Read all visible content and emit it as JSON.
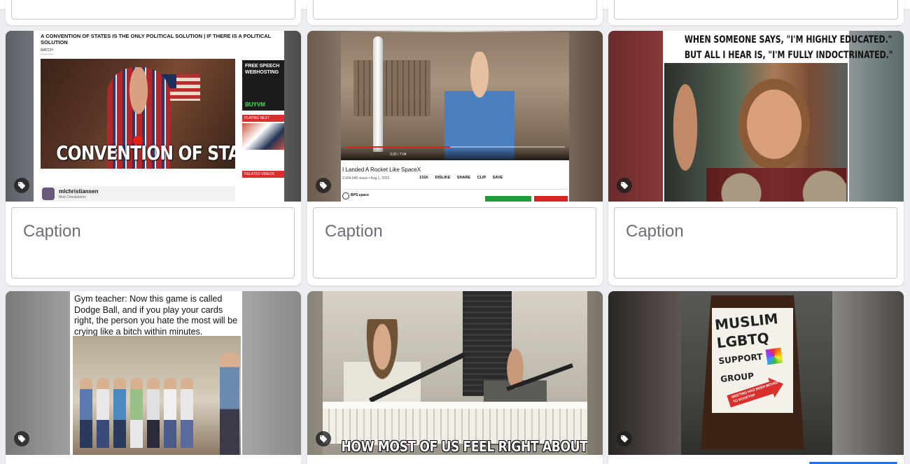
{
  "feed": {
    "caption_placeholder": "Caption",
    "cards": [
      {
        "id": "card-1",
        "title": "A CONVENTION OF STATES IS THE ONLY POLITICAL SOLUTION | IF THERE IS A POLITICAL SOLUTION",
        "watch": "WATCH",
        "overlay": "CONVENTION OF STATES",
        "sidebar_ad": "FREE SPEECH WEBHOSTING",
        "sidebar_ad_brand": "BUYVM",
        "playing_next": "PLAYING NEXT",
        "related_videos": "RELATED VIDEOS",
        "channel": "mlchristiansen",
        "channel_sub": "Matt Christiansen"
      },
      {
        "id": "card-2",
        "title": "I Landed A Rocket Like SpaceX",
        "views": "2,094,045 views • Aug 1, 2022",
        "actions": "131K DISLIKE SHARE CLIP SAVE",
        "time": "3:32 / 7:04",
        "channel": "BPS.space"
      },
      {
        "id": "card-3",
        "line1": "WHEN SOMEONE SAYS, \"I'M HIGHLY EDUCATED.\"",
        "line2": "BUT ALL I HEAR IS, \"I'M FULLY INDOCTRINATED.\""
      },
      {
        "id": "card-4",
        "text": "Gym teacher: Now this game is called Dodge Ball, and if you play your cards right, the person you hate the most will be crying like a bitch within minutes."
      },
      {
        "id": "card-5",
        "text": "HOW MOST OF US FEEL RIGHT ABOUT NOW"
      },
      {
        "id": "card-6",
        "line1": "MUSLIM",
        "line2": "LGBTQ",
        "line3": "SUPPORT GROUP",
        "arrow": "MEETING HAS BEEN MOVED TO ROOFTOP"
      }
    ]
  },
  "icons": {
    "tag": "tag-icon"
  },
  "colors": {
    "background": "#eceef1",
    "card": "#ffffff",
    "accent": "#1a73e8"
  }
}
